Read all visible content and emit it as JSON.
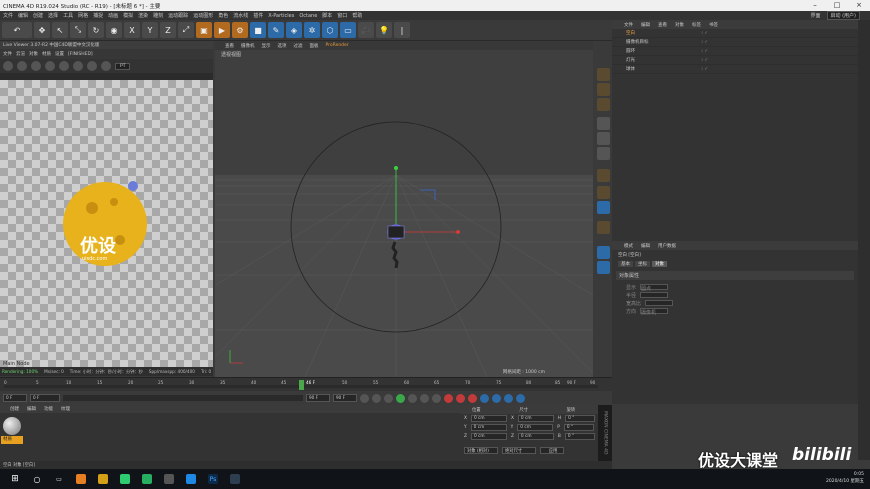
{
  "window": {
    "title": "CINEMA 4D R19.024 Studio (RC - R19) - [未标题 6 *] - 主要"
  },
  "menubar": {
    "items": [
      "文件",
      "编辑",
      "创建",
      "选择",
      "工具",
      "网格",
      "捕捉",
      "动画",
      "模拟",
      "渲染",
      "雕刻",
      "运动跟踪",
      "运动图形",
      "角色",
      "流水线",
      "插件",
      "X-Particles",
      "Octane",
      "脚本",
      "窗口",
      "帮助"
    ],
    "layout_label": "界面",
    "layout_value": "启动 (用户)"
  },
  "live_viewer": {
    "title": "Live Viewer 3.07-R2 中国C4D联盟中文汉化版",
    "menu": [
      "文件",
      "云渲",
      "对象",
      "材质",
      "设置"
    ],
    "status_tag": "[FINISHED]",
    "mode": "PT",
    "info": "Main Node",
    "status": {
      "rendering": "Rendering: 100%",
      "msec": "Ms/sec: 0",
      "time": "Time: 小时：分钟：秒/小时：分钟：秒",
      "spp": "Spp/maxspp: 400/400",
      "tri": "Tri: 0"
    },
    "logo_text": "优设",
    "logo_sub": "uisdc.com"
  },
  "viewport": {
    "menu": [
      "查看",
      "摄像机",
      "显示",
      "选项",
      "过滤",
      "面板",
      "ProRender"
    ],
    "label": "透视视图",
    "grid_info": "网格间距 : 1000 cm"
  },
  "object_manager": {
    "menu": [
      "文件",
      "编辑",
      "查看",
      "对象",
      "标签",
      "书签"
    ],
    "objects": [
      "空白",
      "摄像机目标",
      "圆环",
      "灯光",
      "球体"
    ]
  },
  "attribute_manager": {
    "menu": [
      "模式",
      "编辑",
      "用户数据"
    ],
    "object_line": "空白 [空白]",
    "tabs": [
      "基本",
      "坐标",
      "对象"
    ],
    "active_tab": "对象",
    "section": "对象属性",
    "fields": [
      {
        "label": "显示",
        "value": "圆点"
      },
      {
        "label": "半径",
        "value": ""
      },
      {
        "label": "宽高比",
        "value": ""
      },
      {
        "label": "方向",
        "value": "摄像机"
      }
    ]
  },
  "timeline": {
    "ticks": [
      "0",
      "5",
      "10",
      "15",
      "20",
      "25",
      "30",
      "35",
      "40",
      "45",
      "50",
      "55",
      "60",
      "65",
      "70",
      "75",
      "80",
      "85",
      "90"
    ],
    "current_frame": "46 F",
    "end_label": "90 F",
    "start_field": "0 F",
    "start_field2": "0 F",
    "end_field": "90 F",
    "end_field2": "90 F"
  },
  "material_manager": {
    "menu": [
      "创建",
      "编辑",
      "功能",
      "纹理"
    ],
    "material_name": "材质"
  },
  "coordinates": {
    "headers": [
      "位置",
      "尺寸",
      "旋转"
    ],
    "rows": [
      {
        "axis": "X",
        "pos": "0 cm",
        "size": "0 cm",
        "rot_axis": "H",
        "rot": "0 °"
      },
      {
        "axis": "Y",
        "pos": "0 cm",
        "size": "0 cm",
        "rot_axis": "P",
        "rot": "0 °"
      },
      {
        "axis": "Z",
        "pos": "0 cm",
        "size": "0 cm",
        "rot_axis": "B",
        "rot": "0 °"
      }
    ],
    "mode1": "对象 (相对)",
    "mode2": "绝对尺寸",
    "apply": "应用"
  },
  "brand": "MAXON CINEMA 4D",
  "bottom_status": "空白 对象 [空白]",
  "watermark": {
    "text": "优设大课堂",
    "logo": "bilibili"
  },
  "taskbar": {
    "time": "0:05",
    "date": "2020/4/10 星期五"
  }
}
